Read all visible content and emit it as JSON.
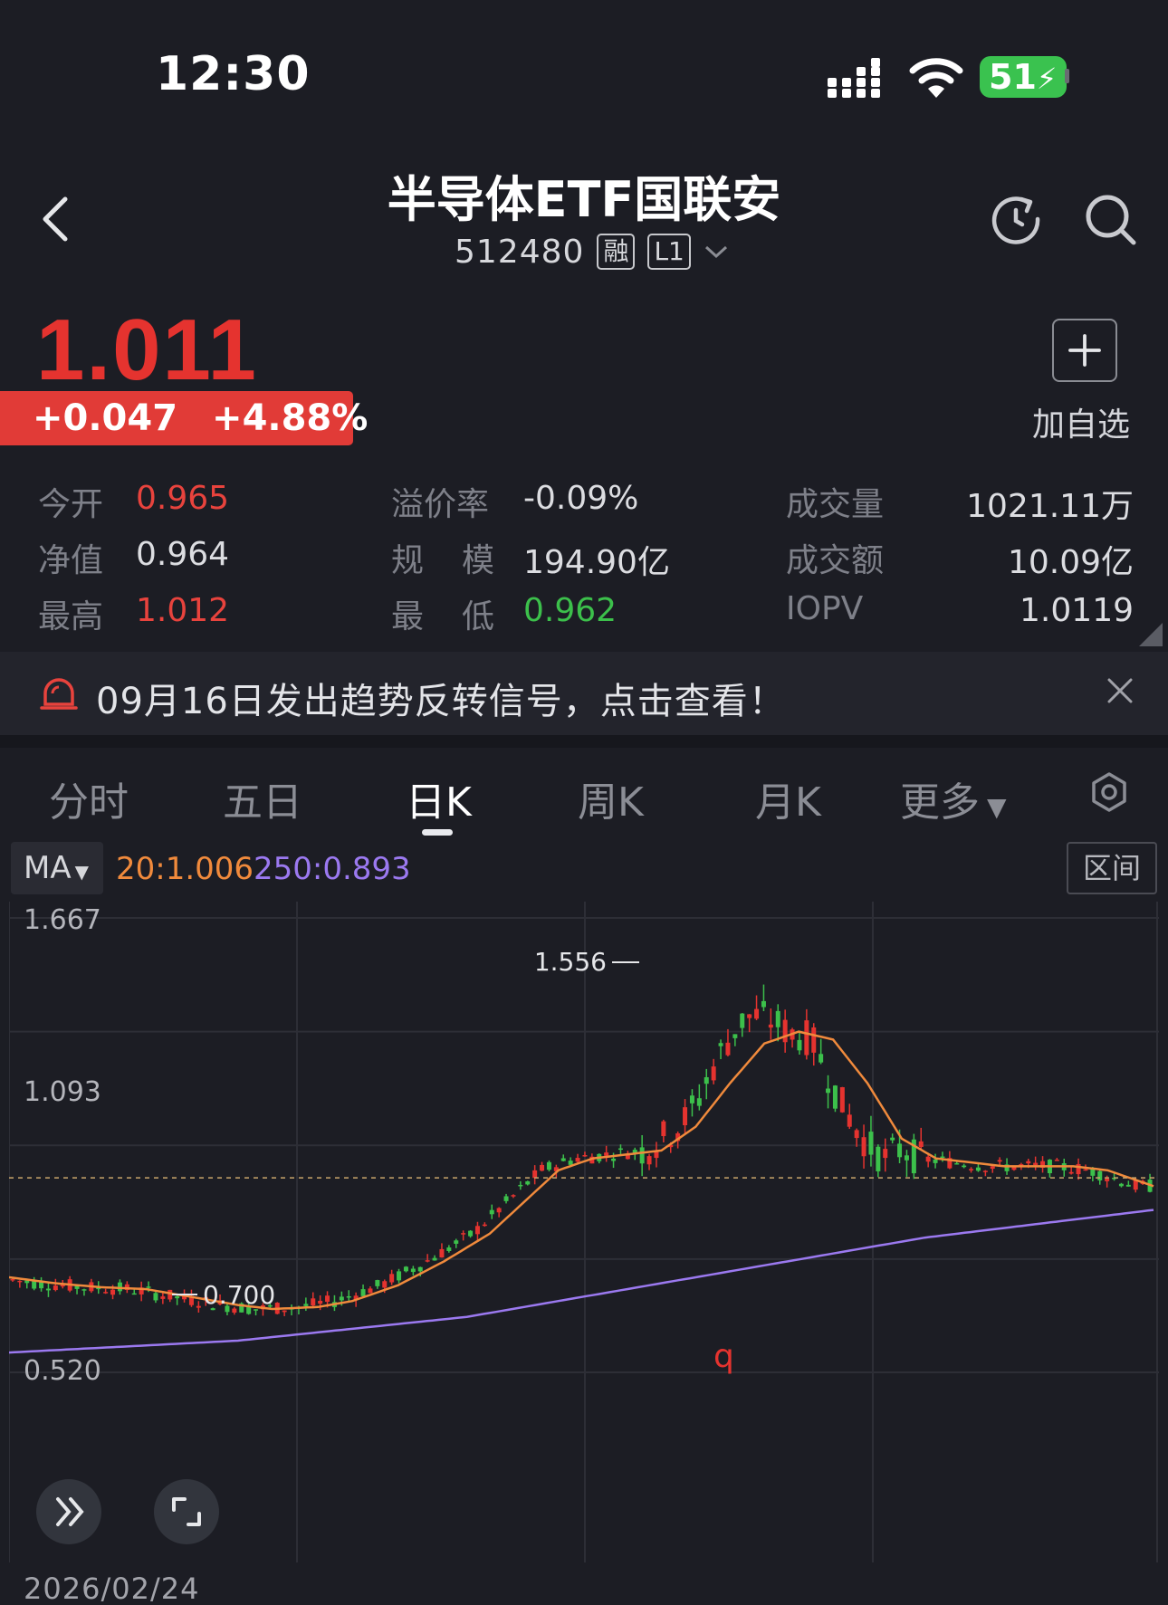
{
  "status_bar": {
    "time": "12:30",
    "battery": "51"
  },
  "header": {
    "title": "半导体ETF国联安",
    "code": "512480",
    "tag_margin": "融",
    "tag_level": "L1"
  },
  "quote": {
    "price": "1.011",
    "change": "+0.047",
    "change_pct": "+4.88%",
    "watchlist_label": "加自选"
  },
  "stats": {
    "open_label": "今开",
    "open_value": "0.965",
    "nav_label": "净值",
    "nav_value": "0.964",
    "high_label": "最高",
    "high_value": "1.012",
    "premium_label": "溢价率",
    "premium_value": "-0.09%",
    "scale_label_1": "规",
    "scale_label_2": "模",
    "scale_value": "194.90亿",
    "low_label_1": "最",
    "low_label_2": "低",
    "low_value": "0.962",
    "volume_label": "成交量",
    "volume_value": "1021.11万",
    "amount_label": "成交额",
    "amount_value": "10.09亿",
    "iopv_label": "IOPV",
    "iopv_value": "1.0119"
  },
  "banner": {
    "text": "09月16日发出趋势反转信号，点击查看！"
  },
  "tabs": [
    {
      "label": "分时"
    },
    {
      "label": "五日"
    },
    {
      "label": "日K"
    },
    {
      "label": "周K"
    },
    {
      "label": "月K"
    },
    {
      "label": "更多"
    }
  ],
  "active_tab": "日K",
  "indicators": {
    "ma_button": "MA",
    "ma20_text": "20:1.006",
    "ma250_text": "250:0.893",
    "range_button": "区间"
  },
  "colors": {
    "up": "#e5332f",
    "down": "#3cc04b",
    "ma20": "#f08a3c",
    "ma250": "#9b79f0",
    "background": "#1c1d24"
  },
  "chart_data": {
    "type": "candlestick",
    "y_axis_labels": [
      "1.667",
      "1.093",
      "0.520"
    ],
    "ylim": [
      0.52,
      1.667
    ],
    "current_price_line": 1.011,
    "annotations": {
      "high": "1.556",
      "low": "0.700",
      "marker": "q"
    },
    "start_date": "2026/02/24",
    "ma20_points": [
      [
        0,
        0.76
      ],
      [
        0.04,
        0.745
      ],
      [
        0.08,
        0.735
      ],
      [
        0.12,
        0.73
      ],
      [
        0.16,
        0.71
      ],
      [
        0.2,
        0.69
      ],
      [
        0.23,
        0.68
      ],
      [
        0.27,
        0.685
      ],
      [
        0.3,
        0.7
      ],
      [
        0.34,
        0.74
      ],
      [
        0.38,
        0.8
      ],
      [
        0.42,
        0.87
      ],
      [
        0.45,
        0.95
      ],
      [
        0.48,
        1.03
      ],
      [
        0.51,
        1.06
      ],
      [
        0.54,
        1.07
      ],
      [
        0.57,
        1.08
      ],
      [
        0.6,
        1.14
      ],
      [
        0.63,
        1.25
      ],
      [
        0.66,
        1.35
      ],
      [
        0.69,
        1.38
      ],
      [
        0.72,
        1.36
      ],
      [
        0.75,
        1.25
      ],
      [
        0.78,
        1.11
      ],
      [
        0.81,
        1.06
      ],
      [
        0.84,
        1.05
      ],
      [
        0.87,
        1.04
      ],
      [
        0.9,
        1.04
      ],
      [
        0.93,
        1.04
      ],
      [
        0.96,
        1.03
      ],
      [
        1.0,
        0.99
      ]
    ],
    "ma250_points": [
      [
        0,
        0.57
      ],
      [
        0.2,
        0.6
      ],
      [
        0.4,
        0.66
      ],
      [
        0.6,
        0.76
      ],
      [
        0.8,
        0.86
      ],
      [
        1.0,
        0.93
      ]
    ]
  }
}
